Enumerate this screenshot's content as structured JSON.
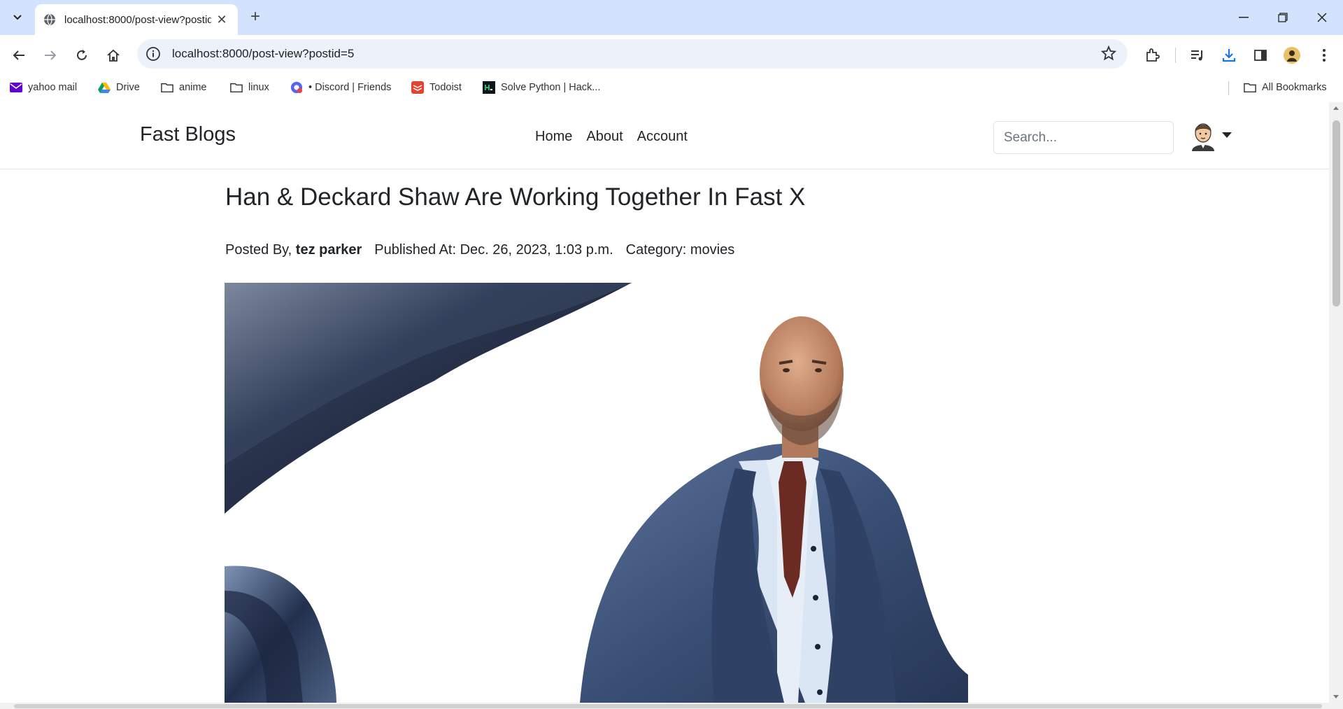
{
  "browser": {
    "tab_title": "localhost:8000/post-view?postid=5",
    "url": "localhost:8000/post-view?postid=5",
    "accent": "#d3e3fd"
  },
  "bookmarks": {
    "items": [
      {
        "label": "yahoo mail",
        "icon": "yahoo-mail-icon"
      },
      {
        "label": "Drive",
        "icon": "google-drive-icon"
      },
      {
        "label": "anime",
        "icon": "folder-icon"
      },
      {
        "label": "linux",
        "icon": "folder-icon"
      },
      {
        "label": "• Discord | Friends",
        "icon": "discord-icon"
      },
      {
        "label": "Todoist",
        "icon": "todoist-icon"
      },
      {
        "label": "Solve Python | Hack...",
        "icon": "hackerrank-icon"
      }
    ],
    "all_bookmarks": "All Bookmarks"
  },
  "site": {
    "brand": "Fast Blogs",
    "nav": [
      "Home",
      "About",
      "Account"
    ],
    "search_placeholder": "Search..."
  },
  "post": {
    "title": "Han & Deckard Shaw Are Working Together In Fast X",
    "posted_by_label": "Posted By,",
    "author": "tez parker",
    "published": "Published At: Dec. 26, 2023, 1:03 p.m.",
    "category": "Category: movies",
    "image_subject": "man-in-blue-suit-image"
  }
}
